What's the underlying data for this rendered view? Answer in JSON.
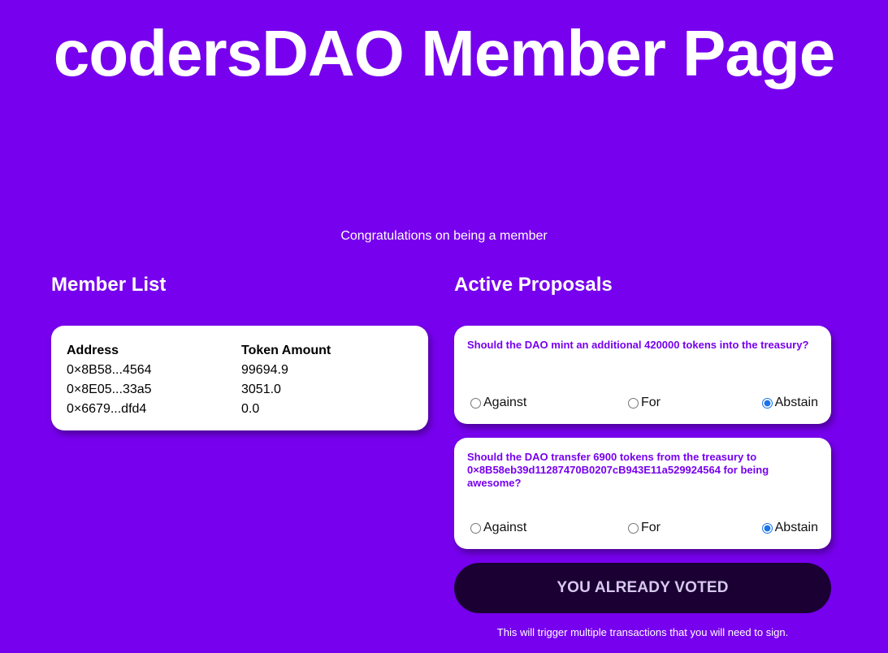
{
  "page": {
    "title": "codersDAO Member Page",
    "subtitle": "Congratulations on being a member"
  },
  "members": {
    "heading": "Member List",
    "columns": [
      "Address",
      "Token Amount"
    ],
    "rows": [
      {
        "address": "0×8B58...4564",
        "amount": "99694.9"
      },
      {
        "address": "0×8E05...33a5",
        "amount": "3051.0"
      },
      {
        "address": "0×6679...dfd4",
        "amount": "0.0"
      }
    ]
  },
  "proposals": {
    "heading": "Active Proposals",
    "items": [
      {
        "text": "Should the DAO mint an additional 420000 tokens into the treasury?",
        "options": [
          "Against",
          "For",
          "Abstain"
        ],
        "selected": "Abstain"
      },
      {
        "text": "Should the DAO transfer 6900 tokens from the treasury to 0×8B58eb39d11287470B0207cB943E11a529924564 for being awesome?",
        "options": [
          "Against",
          "For",
          "Abstain"
        ],
        "selected": "Abstain"
      }
    ],
    "submit_label": "YOU ALREADY VOTED",
    "note": "This will trigger multiple transactions that you will need to sign."
  },
  "colors": {
    "background": "#7700ee",
    "card": "#ffffff",
    "proposal_text": "#7700ee",
    "button_bg": "#1a0033",
    "button_text": "#d8c8ee",
    "radio_selected": "#1a73e8"
  }
}
